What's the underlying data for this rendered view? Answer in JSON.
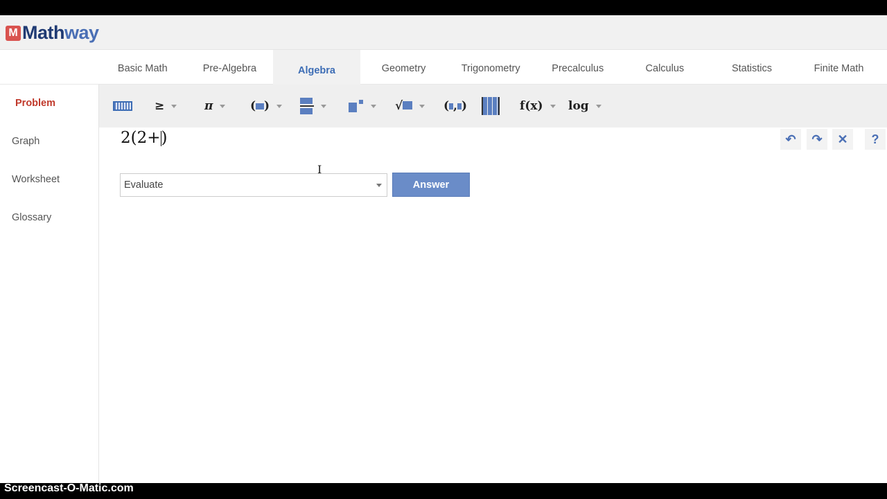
{
  "logo": {
    "mark": "M",
    "text_a": "Math",
    "text_b": "way"
  },
  "tabs": [
    "Basic Math",
    "Pre-Algebra",
    "Algebra",
    "Geometry",
    "Trigonometry",
    "Precalculus",
    "Calculus",
    "Statistics",
    "Finite Math"
  ],
  "active_tab": "Algebra",
  "sidebar": {
    "items": [
      "Problem",
      "Graph",
      "Worksheet",
      "Glossary"
    ]
  },
  "toolbar": {
    "ge": "≥",
    "pi": "π",
    "fx": "f(x)",
    "log": "log"
  },
  "editor": {
    "expr_before": "2(2+",
    "expr_after": ")"
  },
  "actions": {
    "undo": "↶",
    "redo": "↷",
    "clear": "✕",
    "help": "?"
  },
  "action_select": {
    "value": "Evaluate"
  },
  "answer_button": "Answer",
  "watermark": "Screencast-O-Matic.com",
  "colors": {
    "accent": "#6a8cc8",
    "active_side": "#c0392b",
    "active_tab": "#3d6db5"
  }
}
